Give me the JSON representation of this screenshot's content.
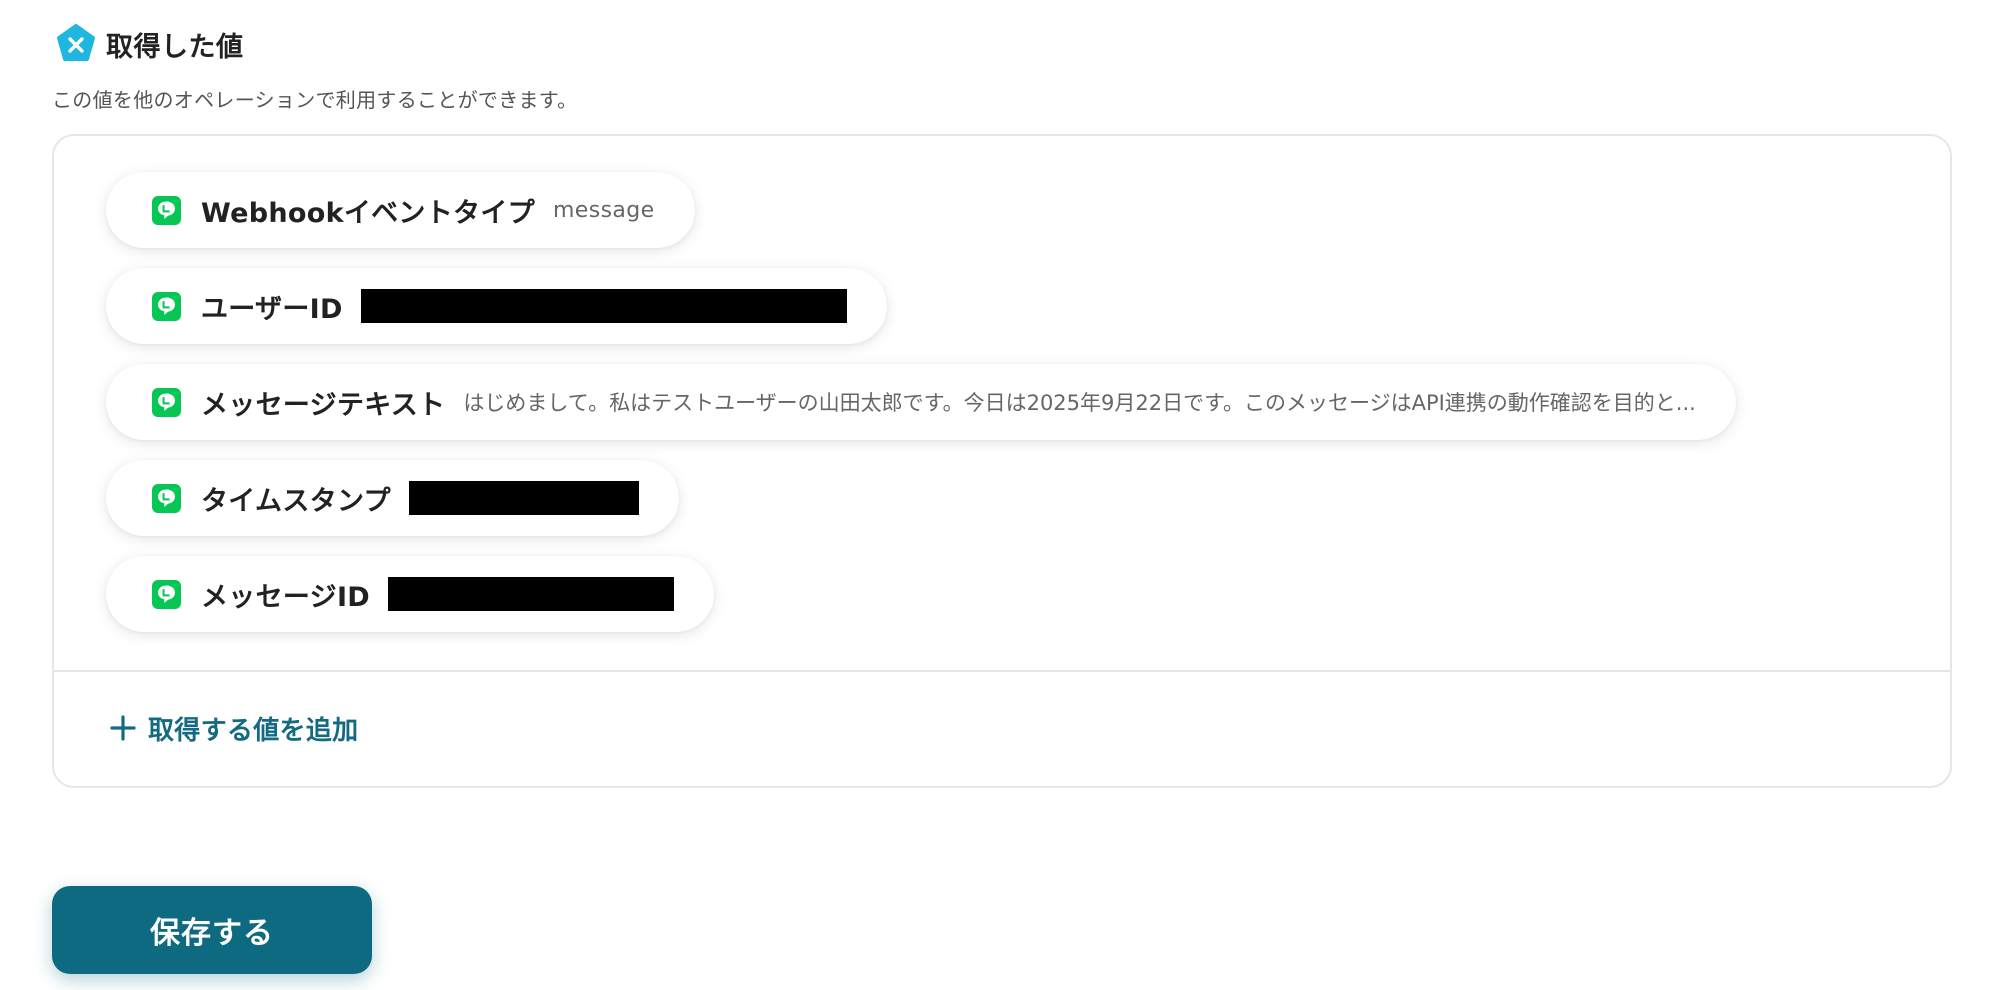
{
  "section": {
    "title": "取得した値",
    "description": "この値を他のオペレーションで利用することができます。",
    "icon": "variable-x-icon",
    "icon_color": "#1fb6e0"
  },
  "fields": [
    {
      "label": "Webhookイベントタイプ",
      "value": "message",
      "redacted": false,
      "icon": "line-app-icon"
    },
    {
      "label": "ユーザーID",
      "value": "",
      "redacted": true,
      "icon": "line-app-icon"
    },
    {
      "label": "メッセージテキスト",
      "value": "はじめまして。私はテストユーザーの山田太郎です。今日は2025年9月22日です。このメッセージはAPI連携の動作確認を目的と...",
      "redacted": false,
      "icon": "line-app-icon"
    },
    {
      "label": "タイムスタンプ",
      "value": "",
      "redacted": true,
      "icon": "line-app-icon"
    },
    {
      "label": "メッセージID",
      "value": "",
      "redacted": true,
      "icon": "line-app-icon"
    }
  ],
  "add_value": {
    "label": "取得する値を追加",
    "icon": "plus-icon"
  },
  "save_button": {
    "label": "保存する"
  },
  "colors": {
    "line_green": "#06c755",
    "accent": "#146a82",
    "button_bg": "#0e6a80",
    "border": "#e3e6ea"
  }
}
